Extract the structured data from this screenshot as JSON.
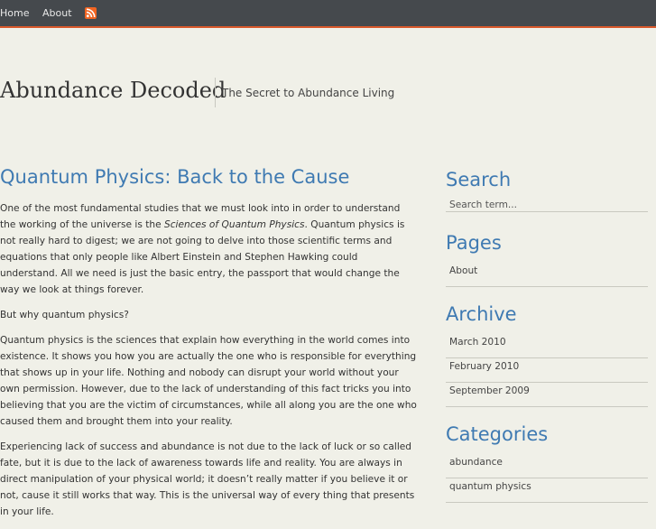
{
  "topnav": {
    "home": "Home",
    "about": "About",
    "rss_icon": "rss-feed-icon"
  },
  "site": {
    "title": "Abundance Decoded",
    "tagline": "The Secret to Abundance Living"
  },
  "post": {
    "title": "Quantum Physics: Back to the Cause",
    "p1_a": "One of the most fundamental studies that we must look into in order to understand the working of the universe is the ",
    "p1_em": "Sciences of Quantum Physics",
    "p1_b": ". Quantum physics is not really hard to digest; we are not going to delve into those scientific terms and equations that only people like Albert Einstein and Stephen Hawking could understand. All we need is just the basic entry, the passport that would change the way we look at things forever.",
    "p2": "But why quantum physics?",
    "p3": "Quantum physics is the sciences that explain how everything in the world comes into existence. It shows you how you are actually the one who is responsible for everything that shows up in your life. Nothing and nobody can disrupt your world without your own permission. However, due to the lack of understanding of this fact tricks you into believing that you are the victim of circumstances, while all along you are the one who caused them and brought them into your reality.",
    "p4": "Experiencing lack of success and abundance is not due to the lack of luck or so called fate, but it is due to the lack of awareness towards life and reality. You are always in direct manipulation of your physical world; it doesn’t really matter if you believe it or not, cause it still works that way. This is the universal way of every thing that presents in your life."
  },
  "sidebar": {
    "search": {
      "title": "Search",
      "placeholder": "Search term..."
    },
    "pages": {
      "title": "Pages",
      "items": [
        "About"
      ]
    },
    "archive": {
      "title": "Archive",
      "items": [
        "March 2010",
        "February 2010",
        "September 2009"
      ]
    },
    "categories": {
      "title": "Categories",
      "items": [
        "abundance",
        "quantum physics"
      ]
    }
  },
  "colors": {
    "background": "#f0f0e8",
    "topbar": "#45494d",
    "accent_line": "#d9582b",
    "link_blue": "#3f7ab2",
    "rss_orange": "#f26522"
  }
}
